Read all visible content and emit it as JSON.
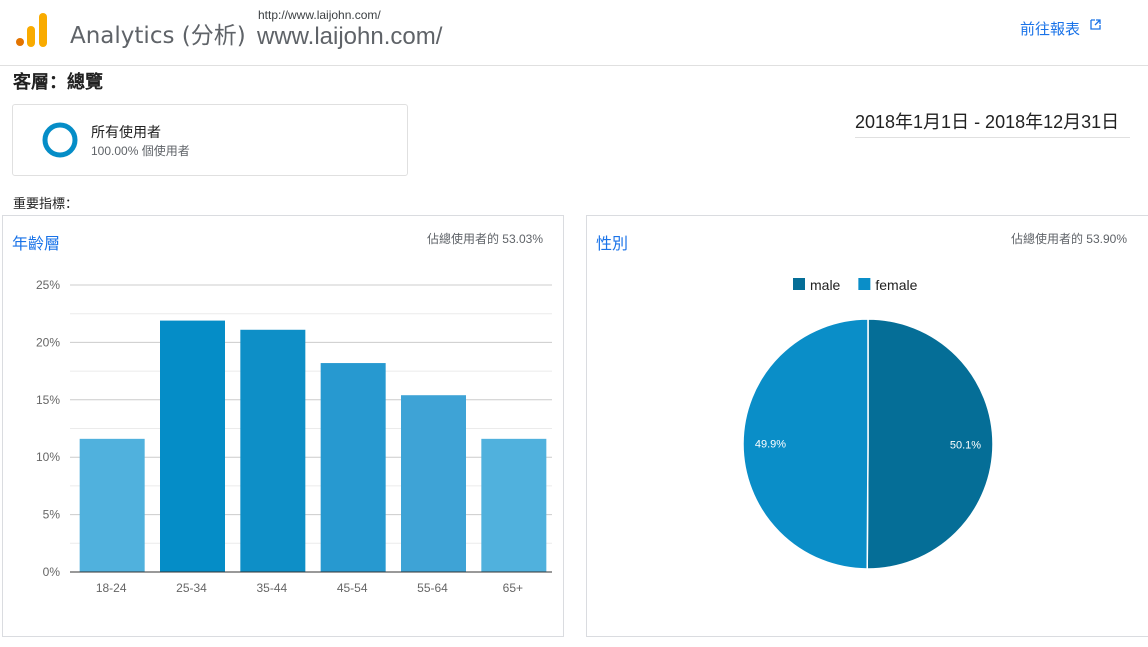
{
  "header": {
    "app_title": "Analytics (分析)",
    "site_url": "http://www.laijohn.com/",
    "site_name": "www.laijohn.com/",
    "report_link": "前往報表"
  },
  "page_title": "客層：總覽",
  "segment": {
    "name": "所有使用者",
    "pct_text": "100.00% 個使用者"
  },
  "date_range": "2018年1月1日 - 2018年12月31日",
  "metrics_label": "重要指標：",
  "colors": {
    "accent": "#1a73e8",
    "logo_orange": "#f9ab00",
    "logo_dark": "#e37400",
    "segment_ring": "#058dc7"
  },
  "chart_data": [
    {
      "type": "bar",
      "title": "年齡層",
      "share_text": "佔總使用者的 53.03%",
      "categories": [
        "18-24",
        "25-34",
        "35-44",
        "45-54",
        "55-64",
        "65+"
      ],
      "values": [
        11.6,
        21.9,
        21.1,
        18.2,
        15.4,
        11.6
      ],
      "colors": [
        "#50b1dd",
        "#058dc7",
        "#0e8fc7",
        "#2799d0",
        "#3ea3d6",
        "#50b1dd"
      ],
      "yticks": [
        "0%",
        "5%",
        "10%",
        "15%",
        "20%",
        "25%"
      ],
      "ylim": [
        0,
        25
      ],
      "grid": true
    },
    {
      "type": "pie",
      "title": "性別",
      "share_text": "佔總使用者的 53.90%",
      "legend_position": "top-center",
      "slices": [
        {
          "name": "male",
          "value": 50.1,
          "label": "50.1%",
          "color": "#056e97"
        },
        {
          "name": "female",
          "value": 49.9,
          "label": "49.9%",
          "color": "#0a8ec8"
        }
      ]
    }
  ]
}
